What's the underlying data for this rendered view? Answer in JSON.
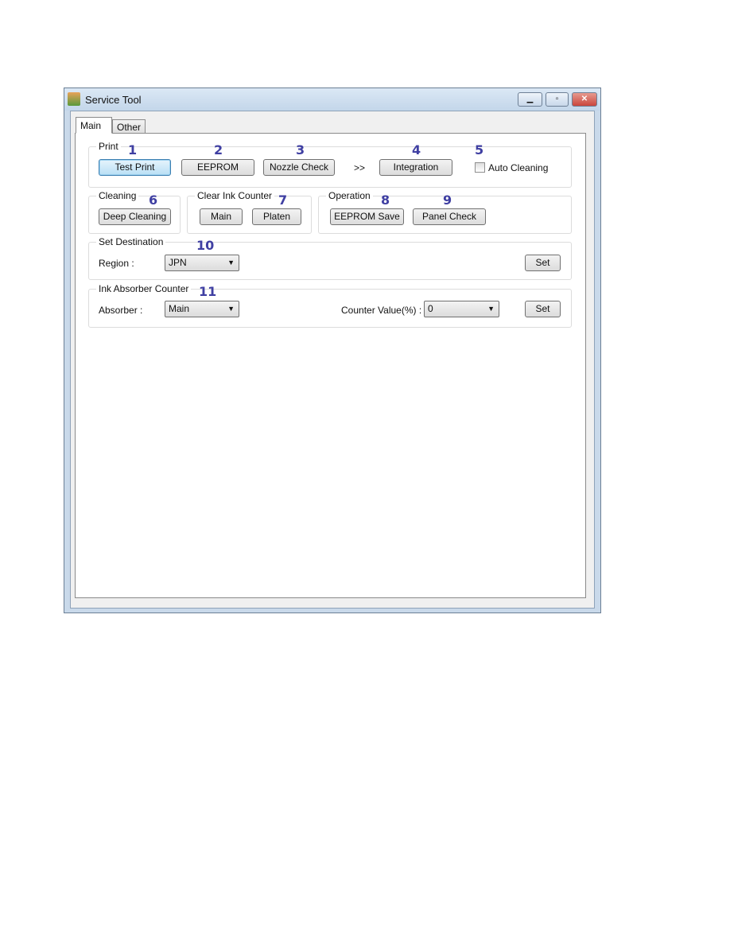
{
  "window": {
    "title": "Service Tool",
    "icon": "printer-app-icon",
    "minimize": "minimize-icon",
    "maximize": "maximize-icon",
    "close": "close-icon"
  },
  "tabs": [
    {
      "label": "Main",
      "active": true
    },
    {
      "label": "Other",
      "active": false
    }
  ],
  "print": {
    "label": "Print",
    "buttons": [
      "Test Print",
      "EEPROM",
      "Nozzle Check",
      "Integration"
    ],
    "arrow": ">>",
    "auto_cleaning": "Auto Cleaning",
    "auto_cleaning_checked": false
  },
  "cleaning": {
    "label": "Cleaning",
    "button": "Deep Cleaning"
  },
  "clear_ink": {
    "label": "Clear Ink Counter",
    "buttons": [
      "Main",
      "Platen"
    ]
  },
  "operation": {
    "label": "Operation",
    "buttons": [
      "EEPROM Save",
      "Panel Check"
    ]
  },
  "destination": {
    "label": "Set Destination",
    "region_label": "Region :",
    "region_value": "JPN",
    "set": "Set"
  },
  "absorber": {
    "label": "Ink Absorber Counter",
    "absorber_label": "Absorber :",
    "absorber_value": "Main",
    "counter_label": "Counter Value(%) :",
    "counter_value": "0",
    "set": "Set"
  },
  "callouts": [
    "1",
    "2",
    "3",
    "4",
    "5",
    "6",
    "7",
    "8",
    "9",
    "10",
    "11"
  ],
  "colors": {
    "callout": "#3f3fa2",
    "titlebar": "#c9d9ea",
    "close": "#c9463d"
  }
}
